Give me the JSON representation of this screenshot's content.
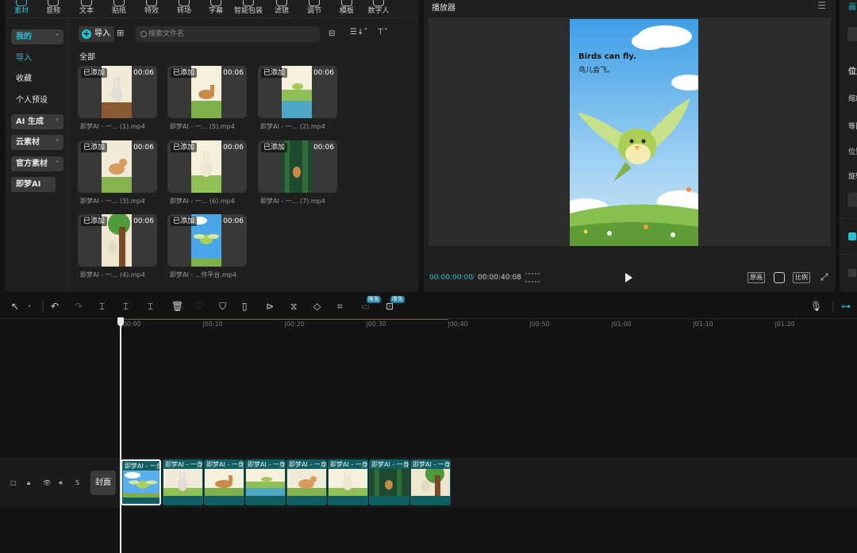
{
  "toolbar": {
    "tabs": [
      {
        "label": "素材",
        "icon": "media-icon",
        "active": true
      },
      {
        "label": "音频",
        "icon": "audio-icon"
      },
      {
        "label": "文本",
        "icon": "text-icon"
      },
      {
        "label": "贴纸",
        "icon": "sticker-icon"
      },
      {
        "label": "特效",
        "icon": "effects-icon"
      },
      {
        "label": "转场",
        "icon": "transition-icon"
      },
      {
        "label": "字幕",
        "icon": "caption-icon"
      },
      {
        "label": "智能包装",
        "icon": "smart-package-icon"
      },
      {
        "label": "滤镜",
        "icon": "filter-icon"
      },
      {
        "label": "调节",
        "icon": "adjust-icon"
      },
      {
        "label": "模板",
        "icon": "template-icon"
      },
      {
        "label": "数字人",
        "icon": "digital-human-icon"
      }
    ]
  },
  "sidebar": {
    "items": [
      {
        "label": "我的",
        "chevron": "˄"
      },
      {
        "label": "导入"
      },
      {
        "label": "收藏"
      },
      {
        "label": "个人预设"
      },
      {
        "label": "AI 生成",
        "chevron": "˅"
      },
      {
        "label": "云素材",
        "chevron": "˅"
      },
      {
        "label": "官方素材",
        "chevron": "˅"
      },
      {
        "label": "即梦AI"
      }
    ]
  },
  "media": {
    "import_label": "导入",
    "search_placeholder": "搜索文件名",
    "section_label": "全部",
    "sort_glyph": "☰↓˅",
    "filter_glyph": "⊤˅",
    "items": [
      {
        "badge": "已添加",
        "duration": "00:06",
        "name": "即梦AI - 一... (1).mp4",
        "thumb": "rabbit"
      },
      {
        "badge": "已添加",
        "duration": "00:06",
        "name": "即梦AI - 一... (5).mp4",
        "thumb": "horse"
      },
      {
        "badge": "已添加",
        "duration": "00:06",
        "name": "即梦AI - 一... (2).mp4",
        "thumb": "lake"
      },
      {
        "badge": "已添加",
        "duration": "00:06",
        "name": "即梦AI - 一... (3).mp4",
        "thumb": "dog"
      },
      {
        "badge": "已添加",
        "duration": "00:06",
        "name": "即梦AI - 一... (6).mp4",
        "thumb": "rabbit2"
      },
      {
        "badge": "已添加",
        "duration": "00:06",
        "name": "即梦AI - 一... (7).mp4",
        "thumb": "forest"
      },
      {
        "badge": "已添加",
        "duration": "00:06",
        "name": "即梦AI - 一... (4).mp4",
        "thumb": "tree"
      },
      {
        "badge": "已添加",
        "duration": "00:06",
        "name": "即梦AI - ...作平台.mp4",
        "thumb": "bird"
      }
    ]
  },
  "player": {
    "title": "播放器",
    "caption_en": "Birds can fly.",
    "caption_cn": "鸟儿会飞。",
    "time_current": "00:00:00:00",
    "time_sep": "/",
    "time_total": "00:00:40:08",
    "btn_original": "原画",
    "btn_ratio": "比例"
  },
  "right_panel": {
    "labels": [
      "画面",
      "位置",
      "缩放",
      "等比",
      "位置",
      "旋转"
    ]
  },
  "timeline": {
    "free_badge": "限免",
    "ruler": [
      "|00:00",
      "|00:10",
      "|00:20",
      "|00:30",
      "|00:40",
      "|00:50",
      "|01:00",
      "|01:10",
      "|01:20"
    ],
    "cover_label": "封面",
    "track_icons": [
      "▢",
      "🔒︎",
      "👁︎",
      "🔊︎",
      "S"
    ],
    "clips": [
      {
        "title": "即梦AI - 一身",
        "thumb": "bird"
      },
      {
        "title": "即梦AI - 一身",
        "thumb": "rabbit"
      },
      {
        "title": "即梦AI - 一身",
        "thumb": "horse"
      },
      {
        "title": "即梦AI - 一身",
        "thumb": "lake"
      },
      {
        "title": "即梦AI - 一身",
        "thumb": "dog"
      },
      {
        "title": "即梦AI - 一身",
        "thumb": "rabbit2"
      },
      {
        "title": "即梦AI - 一身",
        "thumb": "forest"
      },
      {
        "title": "即梦AI - 一身",
        "thumb": "tree"
      }
    ]
  },
  "colors": {
    "accent": "#22c3d0",
    "clip": "#0f5e62"
  }
}
